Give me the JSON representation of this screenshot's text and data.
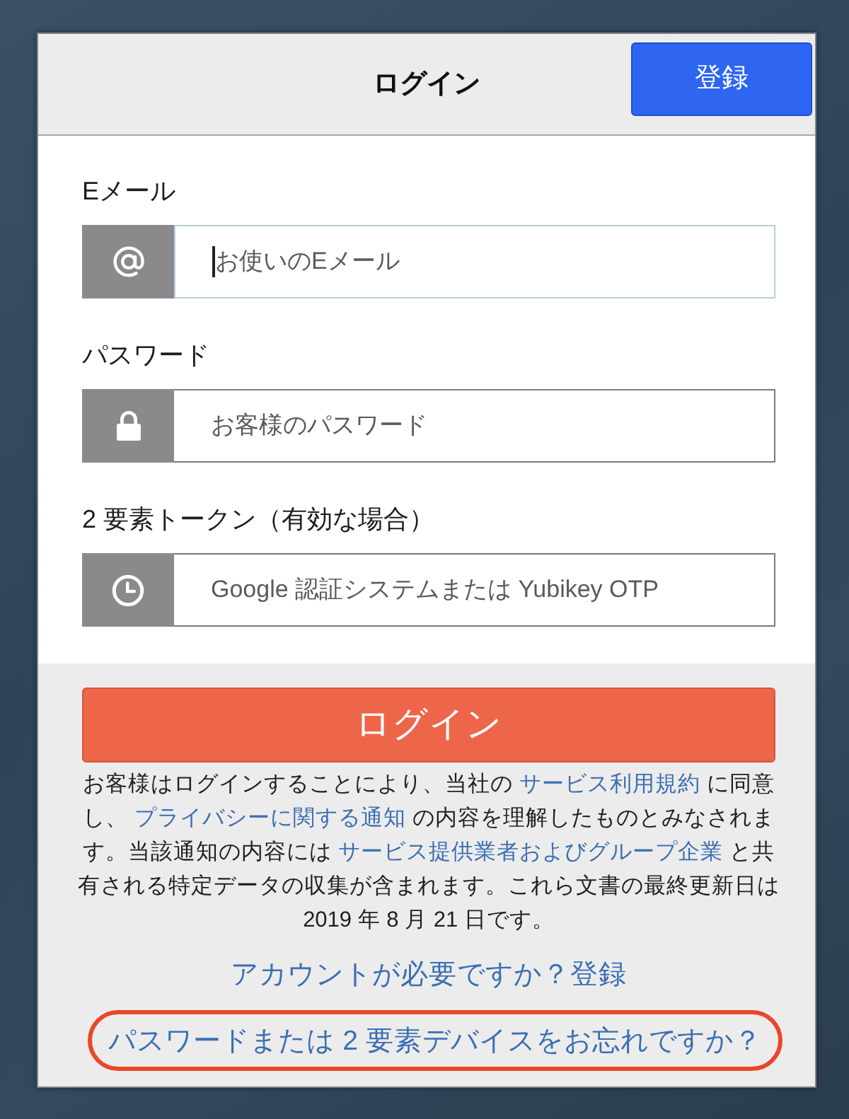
{
  "dialog": {
    "title": "ログイン",
    "register_button": "登録"
  },
  "fields": [
    {
      "kind": "email",
      "label": "Eメール",
      "placeholder": "お使いのEメール",
      "focused": true
    },
    {
      "kind": "password",
      "label": "パスワード",
      "placeholder": "お客様のパスワード",
      "focused": false
    },
    {
      "kind": "token",
      "label": "2 要素トークン（有効な場合）",
      "placeholder": "Google 認証システムまたは Yubikey OTP",
      "focused": false
    }
  ],
  "login_button": "ログイン",
  "legal_text": [
    {
      "kind": "text",
      "text": "お客様はログインすることにより、当社の "
    },
    {
      "kind": "link",
      "text": "サービス利用規約"
    },
    {
      "kind": "text",
      "text": " に同意し、 "
    },
    {
      "kind": "link",
      "text": "プライバシーに関する通知"
    },
    {
      "kind": "text",
      "text": " の内容を理解したものとみなされます。当該通知の内容には "
    },
    {
      "kind": "link",
      "text": "サービス提供業者およびグループ企業"
    },
    {
      "kind": "text",
      "text": " と共有される特定データの収集が含まれます。これら文書の最終更新日は 2019 年 8 月 21 日です。"
    }
  ],
  "account_link": "アカウントが必要ですか？登録",
  "forgot_link": {
    "text": "パスワードまたは 2 要素デバイスをお忘れですか？",
    "highlighted": true
  }
}
